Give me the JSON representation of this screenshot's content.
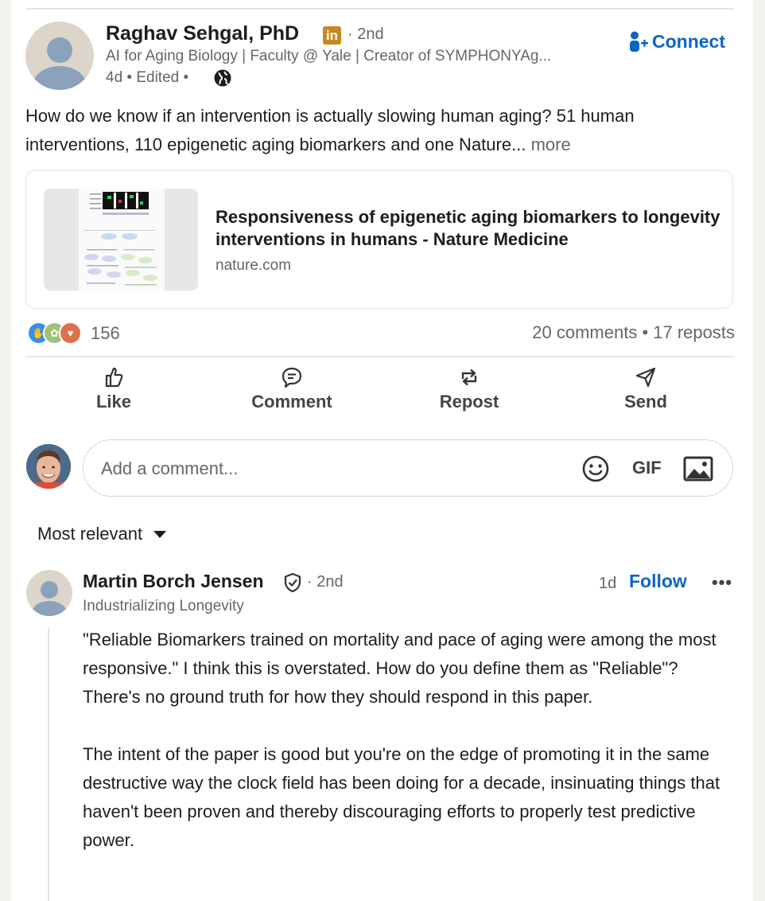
{
  "post": {
    "author": {
      "name": "Raghav Sehgal, PhD",
      "badge": "in",
      "degree": "· 2nd",
      "headline": "AI for Aging Biology | Faculty @ Yale | Creator of SYMPHONYAg...",
      "meta": "4d • Edited •"
    },
    "connect_label": "Connect",
    "text": "How do we know if an intervention is actually slowing human aging? 51 human interventions, 110 epigenetic aging biomarkers and one Nature...",
    "more_label": "more",
    "link_card": {
      "title": "Responsiveness of epigenetic aging biomarkers to longevity interventions in humans - Nature Medicine",
      "source": "nature.com"
    },
    "reaction_count": "156",
    "comments_reposts": "20 comments • 17 reposts",
    "actions": {
      "like": "Like",
      "comment": "Comment",
      "repost": "Repost",
      "send": "Send"
    }
  },
  "comment_input": {
    "placeholder": "Add a comment...",
    "gif_label": "GIF"
  },
  "sort_label": "Most relevant",
  "comment": {
    "name": "Martin Borch Jensen",
    "degree": "· 2nd",
    "headline": "Industrializing Longevity",
    "time": "1d",
    "follow_label": "Follow",
    "more_label": "•••",
    "body": [
      "\"Reliable Biomarkers trained on mortality and pace of aging were among the most responsive.\" I think this is overstated. How do you define them as \"Reliable\"?",
      "There's no ground truth for how they should respond in this paper.",
      "The intent of the paper is good but you're on the edge of promoting it in the same destructive way the clock field has been doing for a decade, insinuating things that haven't been proven and thereby discouraging efforts to properly test predictive power."
    ]
  },
  "colors": {
    "accent": "#0a66c2",
    "badge": "#c58a1f",
    "text_primary": "#1d1d1d",
    "text_secondary": "#666666",
    "divider": "#e6e6e6"
  }
}
